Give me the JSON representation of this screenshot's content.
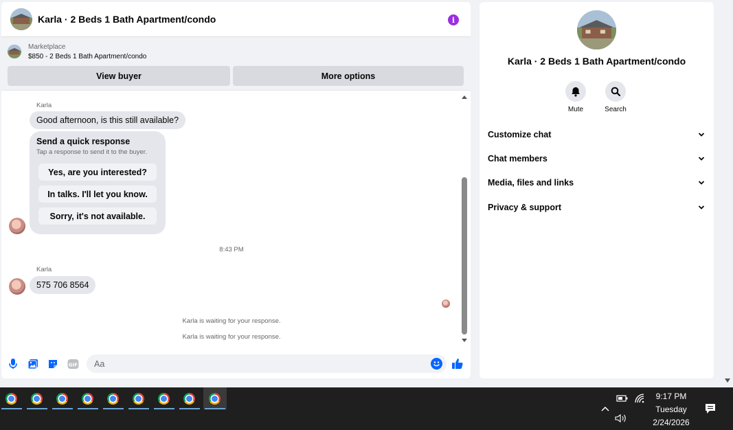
{
  "header": {
    "title": "Karla · 2 Beds 1 Bath Apartment/condo",
    "info_icon": "info-icon",
    "accent": "#9b2fe0"
  },
  "listing": {
    "category": "Marketplace",
    "title": "$850 - 2 Beds 1 Bath Apartment/condo",
    "view_buyer": "View buyer",
    "more_options": "More options"
  },
  "messages": {
    "sender1": "Karla",
    "msg1": "Good afternoon, is this still available?",
    "quick_title": "Send a quick response",
    "quick_sub": "Tap a response to send it to the buyer.",
    "quick_options": [
      "Yes, are you interested?",
      "In talks. I'll let you know.",
      "Sorry, it's not available."
    ],
    "time": "8:43 PM",
    "sender2": "Karla",
    "msg2": "575 706 8564",
    "waiting1": "Karla is waiting for your response.",
    "waiting2": "Karla is waiting for your response."
  },
  "composer": {
    "placeholder": "Aa",
    "brand": "#0866ff"
  },
  "info_panel": {
    "title": "Karla · 2 Beds 1 Bath Apartment/condo",
    "mute": "Mute",
    "search": "Search",
    "sections": [
      "Customize chat",
      "Chat members",
      "Media, files and links",
      "Privacy & support"
    ]
  },
  "taskbar": {
    "app_count": 9,
    "time": "9:17 PM",
    "day": "Tuesday",
    "date": "2/24/2026"
  }
}
